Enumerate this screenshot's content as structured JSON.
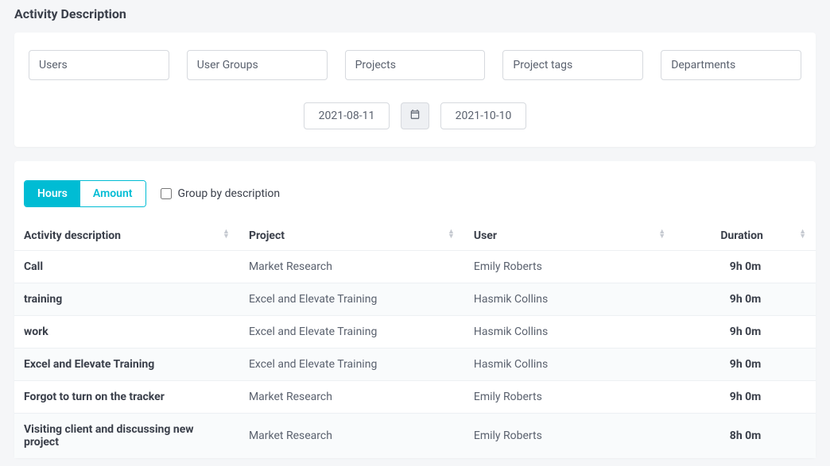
{
  "pageTitle": "Activity Description",
  "filters": {
    "users": "Users",
    "userGroups": "User Groups",
    "projects": "Projects",
    "projectTags": "Project tags",
    "departments": "Departments"
  },
  "dates": {
    "start": "2021-08-11",
    "end": "2021-10-10"
  },
  "toggle": {
    "hours": "Hours",
    "amount": "Amount"
  },
  "groupByLabel": "Group by description",
  "columns": {
    "activity": "Activity description",
    "project": "Project",
    "user": "User",
    "duration": "Duration"
  },
  "rows": [
    {
      "activity": "Call",
      "project": "Market Research",
      "user": "Emily Roberts",
      "duration": "9h 0m"
    },
    {
      "activity": "training",
      "project": "Excel and Elevate Training",
      "user": "Hasmik Collins",
      "duration": "9h 0m"
    },
    {
      "activity": "work",
      "project": "Excel and Elevate Training",
      "user": "Hasmik Collins",
      "duration": "9h 0m"
    },
    {
      "activity": "Excel and Elevate Training",
      "project": "Excel and Elevate Training",
      "user": "Hasmik Collins",
      "duration": "9h 0m"
    },
    {
      "activity": "Forgot to turn on the tracker",
      "project": "Market Research",
      "user": "Emily Roberts",
      "duration": "9h 0m"
    },
    {
      "activity": "Visiting client and discussing new project",
      "project": "Market Research",
      "user": "Emily Roberts",
      "duration": "8h 0m"
    }
  ]
}
